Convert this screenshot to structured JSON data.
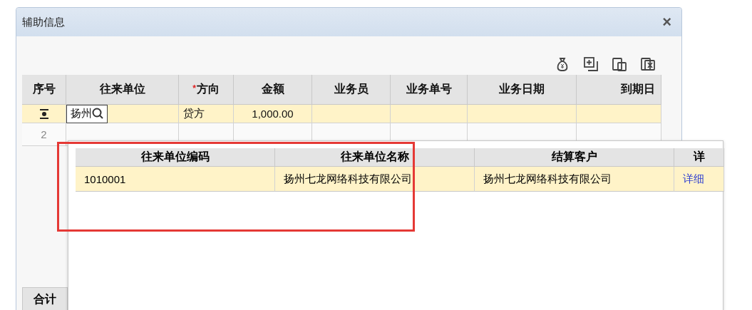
{
  "dialog": {
    "title": "辅助信息",
    "close": "×"
  },
  "table": {
    "columns": [
      {
        "label": "序号"
      },
      {
        "label": "往来单位"
      },
      {
        "label": "方向",
        "marker": "*"
      },
      {
        "label": "金额"
      },
      {
        "label": "业务员"
      },
      {
        "label": "业务单号"
      },
      {
        "label": "业务日期"
      },
      {
        "label": "到期日"
      }
    ],
    "rows": [
      {
        "kind": "editing",
        "selected": true,
        "unit": "扬州",
        "direction": "贷方",
        "amount": "1,000.00"
      },
      {
        "kind": "number",
        "selected": false,
        "number": "2"
      }
    ],
    "footer": "合计"
  },
  "lookup": {
    "columns": [
      "往来单位编码",
      "往来单位名称",
      "结算客户",
      "详"
    ],
    "rows": [
      {
        "selected": true,
        "code": "1010001",
        "name": "扬州七龙网络科技有限公司",
        "customer": "扬州七龙网络科技有限公司",
        "link": "详细"
      }
    ]
  },
  "highlight_box": true
}
